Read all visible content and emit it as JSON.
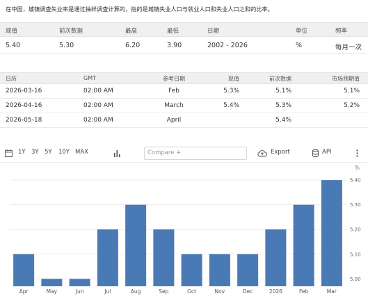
{
  "description": "在中国，城镇调查失业率是通过抽样调查计算的，指的是城镇失业人口与就业人口和失业人口之和的比率。",
  "summary": {
    "headers": [
      "现值",
      "前次数据",
      "最高",
      "最低",
      "日期",
      "单位",
      "频率"
    ],
    "values": [
      "5.40",
      "5.30",
      "6.20",
      "3.90",
      "2002 - 2026",
      "%",
      "每月一次"
    ]
  },
  "calendar": {
    "headers": [
      "日历",
      "GMT",
      "参考日期",
      "现值",
      "前次数据",
      "市场预期值"
    ],
    "rows": [
      [
        "2026-03-16",
        "02:00 AM",
        "Feb",
        "5.3%",
        "5.1%",
        "5.1%"
      ],
      [
        "2026-04-16",
        "02:00 AM",
        "March",
        "5.4%",
        "5.3%",
        "5.2%"
      ],
      [
        "2026-05-18",
        "02:00 AM",
        "April",
        "",
        "5.4%",
        ""
      ]
    ]
  },
  "toolbar": {
    "ranges": [
      "1Y",
      "3Y",
      "5Y",
      "10Y",
      "MAX"
    ],
    "compare_placeholder": "Compare +",
    "export_label": "Export",
    "api_label": "API",
    "icons": [
      "calendar-icon",
      "bar-chart-icon",
      "cloud-upload-icon",
      "database-icon",
      "more-vertical-icon"
    ]
  },
  "colors": {
    "bar": "#4a7ab5",
    "header_band": "#f0f0f0",
    "grid": "#ebebeb"
  },
  "chart_data": {
    "type": "bar",
    "unit": "%",
    "categories": [
      "Apr",
      "May",
      "Jun",
      "Jul",
      "Aug",
      "Sep",
      "Oct",
      "Nov",
      "Dec",
      "2026",
      "Feb",
      "Mar"
    ],
    "values": [
      5.1,
      5.0,
      5.0,
      5.2,
      5.3,
      5.2,
      5.1,
      5.1,
      5.1,
      5.2,
      5.3,
      5.4
    ],
    "yticks": [
      5.0,
      5.1,
      5.2,
      5.3,
      5.4
    ],
    "ytick_labels": [
      "5.00",
      "5.10",
      "5.20",
      "5.30",
      "5.40"
    ],
    "ylim": [
      4.97,
      5.42
    ],
    "grid": true,
    "y_axis_side": "right"
  }
}
